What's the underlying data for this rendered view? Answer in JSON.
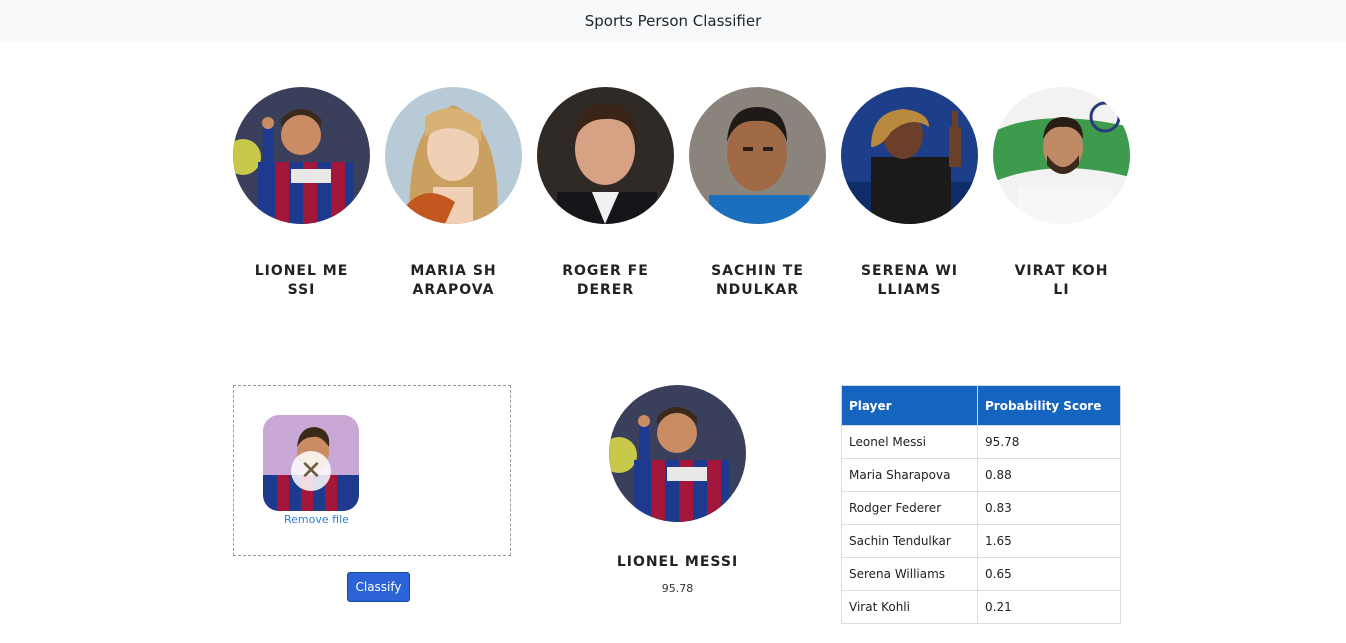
{
  "navbar": {
    "title": "Sports Person Classifier"
  },
  "players": [
    {
      "name": "LIONEL MESSI"
    },
    {
      "name": "MARIA SHARAPOVA"
    },
    {
      "name": "ROGER FEDERER"
    },
    {
      "name": "SACHIN TENDULKAR"
    },
    {
      "name": "SERENA WILLIAMS"
    },
    {
      "name": "VIRAT KOHLI"
    }
  ],
  "upload": {
    "remove_label": "Remove file",
    "remove_symbol": "✕",
    "classify_label": "Classify"
  },
  "result": {
    "name": "LIONEL MESSI",
    "score": "95.78"
  },
  "table": {
    "headers": [
      "Player",
      "Probability Score"
    ],
    "rows": [
      [
        "Leonel Messi",
        "95.78"
      ],
      [
        "Maria Sharapova",
        "0.88"
      ],
      [
        "Rodger Federer",
        "0.83"
      ],
      [
        "Sachin Tendulkar",
        "1.65"
      ],
      [
        "Serena Williams",
        "0.65"
      ],
      [
        "Virat Kohli",
        "0.21"
      ]
    ]
  }
}
